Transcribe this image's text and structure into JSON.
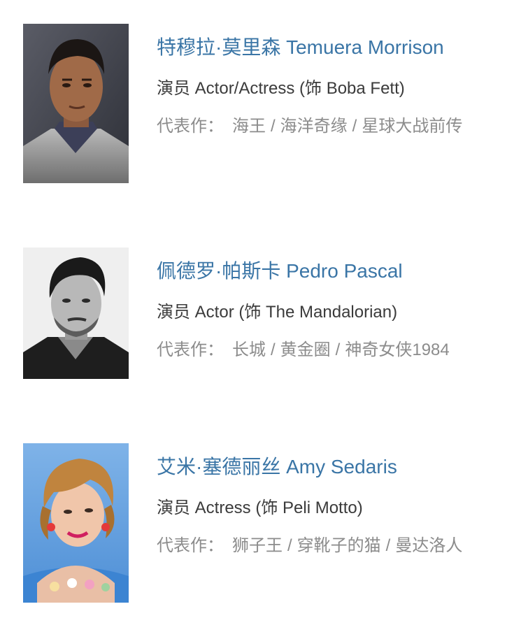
{
  "cast": [
    {
      "name": "特穆拉·莫里森 Temuera Morrison",
      "role": "演员 Actor/Actress (饰 Boba Fett)",
      "works_label": "代表作：",
      "works": [
        "海王",
        "海洋奇缘",
        "星球大战前传"
      ],
      "photo_icon": "temuera-morrison-portrait"
    },
    {
      "name": "佩德罗·帕斯卡 Pedro Pascal",
      "role": "演员 Actor (饰 The Mandalorian)",
      "works_label": "代表作：",
      "works": [
        "长城",
        "黄金圈",
        "神奇女侠1984"
      ],
      "photo_icon": "pedro-pascal-portrait"
    },
    {
      "name": "艾米·塞德丽丝 Amy Sedaris",
      "role": "演员 Actress (饰 Peli Motto)",
      "works_label": "代表作：",
      "works": [
        "狮子王",
        "穿靴子的猫",
        "曼达洛人"
      ],
      "photo_icon": "amy-sedaris-portrait"
    }
  ],
  "colors": {
    "name_link": "#3a75a6",
    "role_text": "#3b3b3b",
    "works_text": "#8c8c8c"
  }
}
